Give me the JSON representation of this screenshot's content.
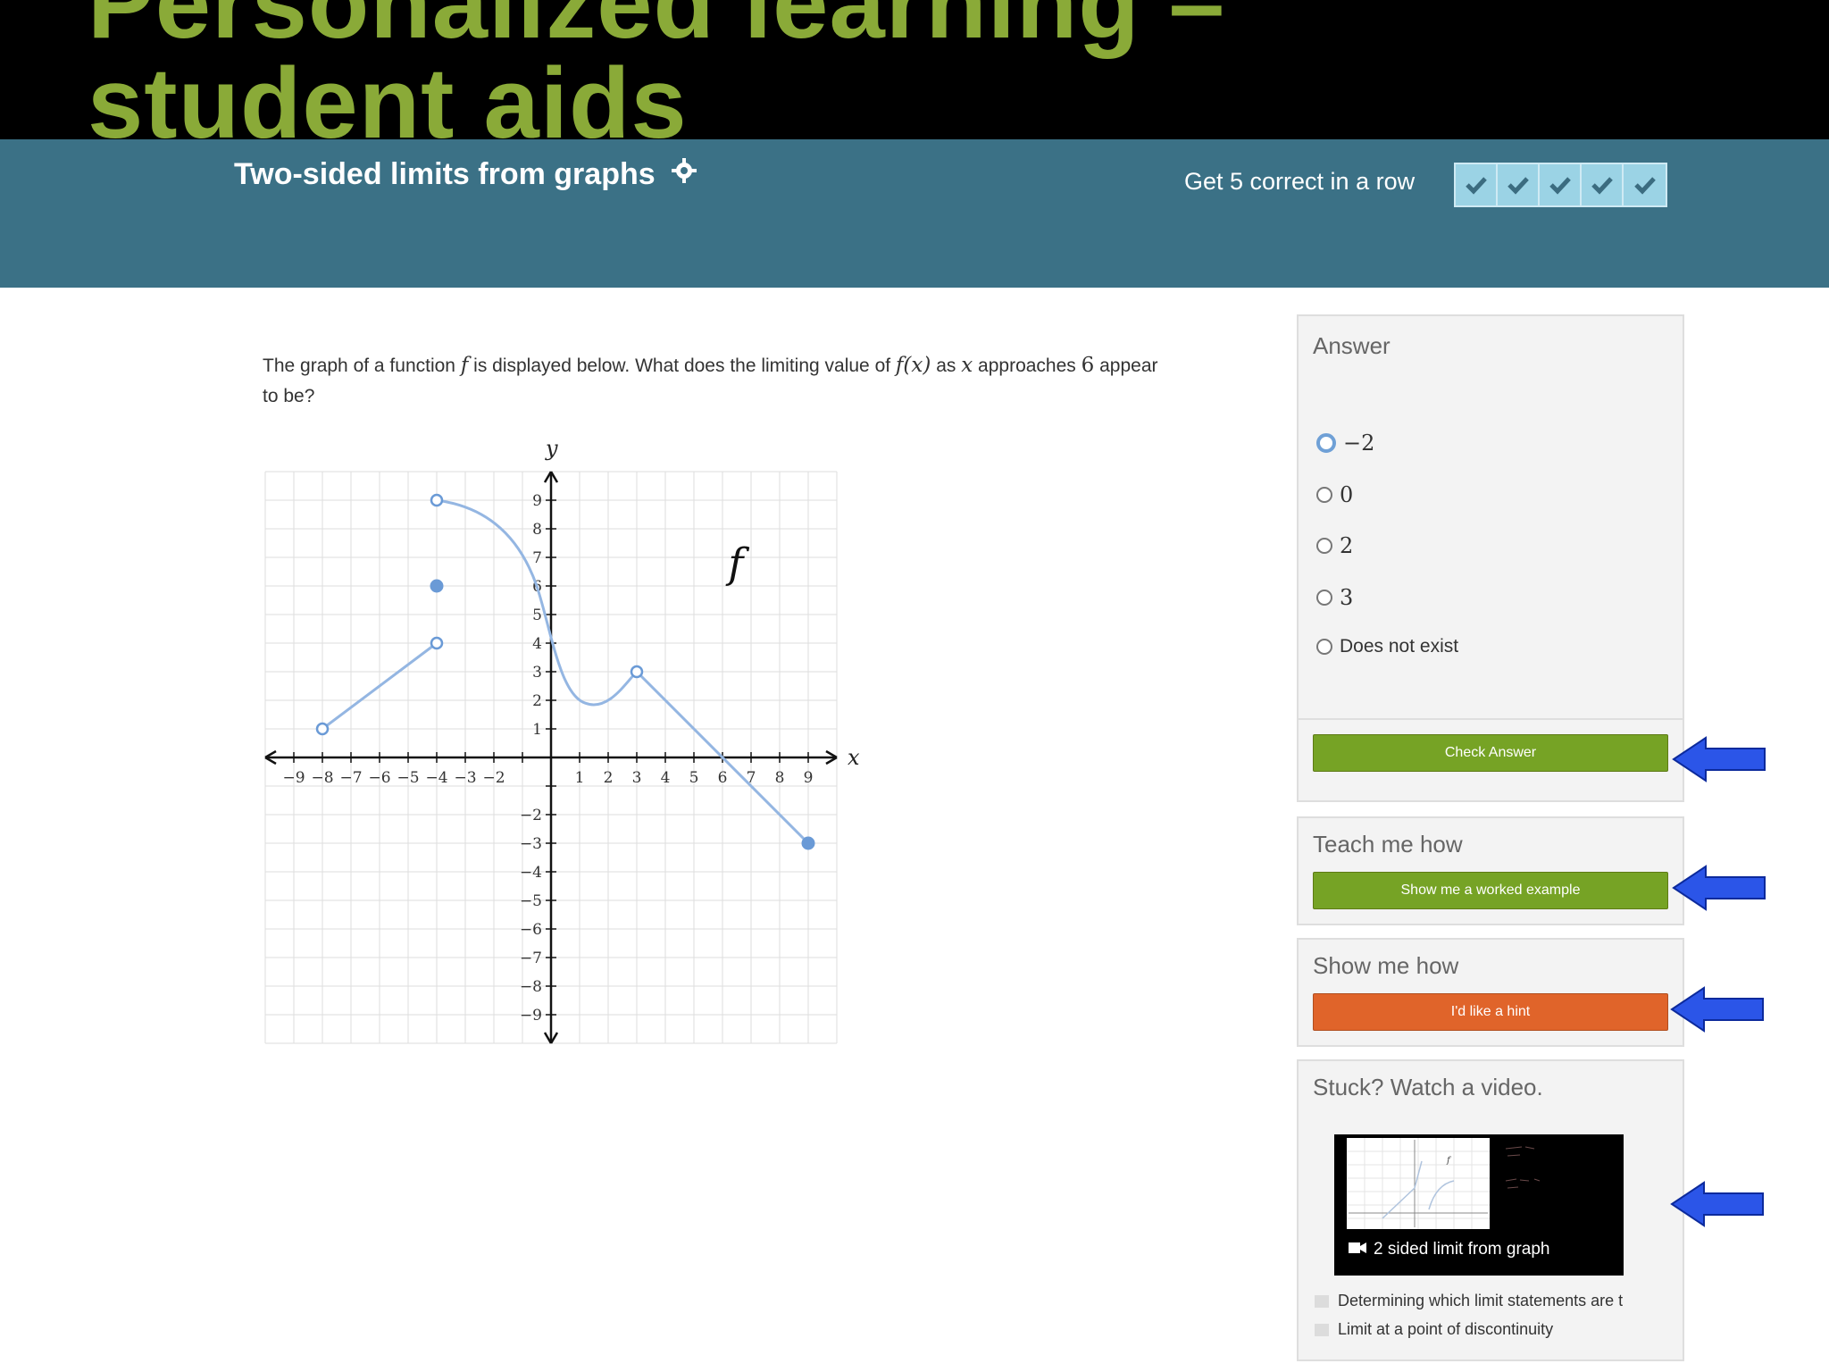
{
  "slide": {
    "title_line1": "Personalized learning –",
    "title_line2": "student aids"
  },
  "header": {
    "exercise_title": "Two-sided limits from graphs",
    "streak_label": "Get 5 correct in a row",
    "streak_count": 5
  },
  "question": {
    "text_1": "The graph of a function ",
    "f": "f",
    "text_2": " is displayed below. What does the limiting value of ",
    "fx": "f(x)",
    "text_3": " as ",
    "x": "x",
    "text_4": " approaches ",
    "six": "6",
    "text_5": " appear",
    "line2": "to be?"
  },
  "graph": {
    "y_axis_label": "y",
    "x_axis_label": "x",
    "function_label": "f",
    "x_ticks_neg": [
      "−9",
      "−8",
      "−7",
      "−6",
      "−5",
      "−4",
      "−3",
      "−2"
    ],
    "x_ticks_pos": [
      "1",
      "2",
      "3",
      "4",
      "5",
      "6",
      "7",
      "8",
      "9"
    ],
    "y_ticks_pos": [
      "9",
      "8",
      "7",
      "6",
      "5",
      "4",
      "3",
      "2",
      "1"
    ],
    "y_ticks_neg": [
      "−2",
      "−3",
      "−4",
      "−5",
      "−6",
      "−7",
      "−8",
      "−9"
    ],
    "curve_color": "#94b6e2",
    "point_color": "#6a9ad6"
  },
  "answer_panel": {
    "title": "Answer",
    "options": [
      "−2",
      "0",
      "2",
      "3",
      "Does not exist"
    ],
    "selected_index": 0,
    "check_button": "Check Answer"
  },
  "teach_panel": {
    "title": "Teach me how",
    "button": "Show me a worked example"
  },
  "show_panel": {
    "title": "Show me how",
    "button": "I'd like a hint"
  },
  "video_panel": {
    "title": "Stuck? Watch a video.",
    "video_caption": "2 sided limit from graph",
    "related": [
      "Determining which limit statements are t",
      "Limit at a point of discontinuity"
    ]
  },
  "colors": {
    "title_green": "#8aaa38",
    "header_teal": "#3b7186",
    "button_green": "#76a325",
    "button_orange": "#e0642a",
    "arrow_blue": "#2b55e8"
  }
}
